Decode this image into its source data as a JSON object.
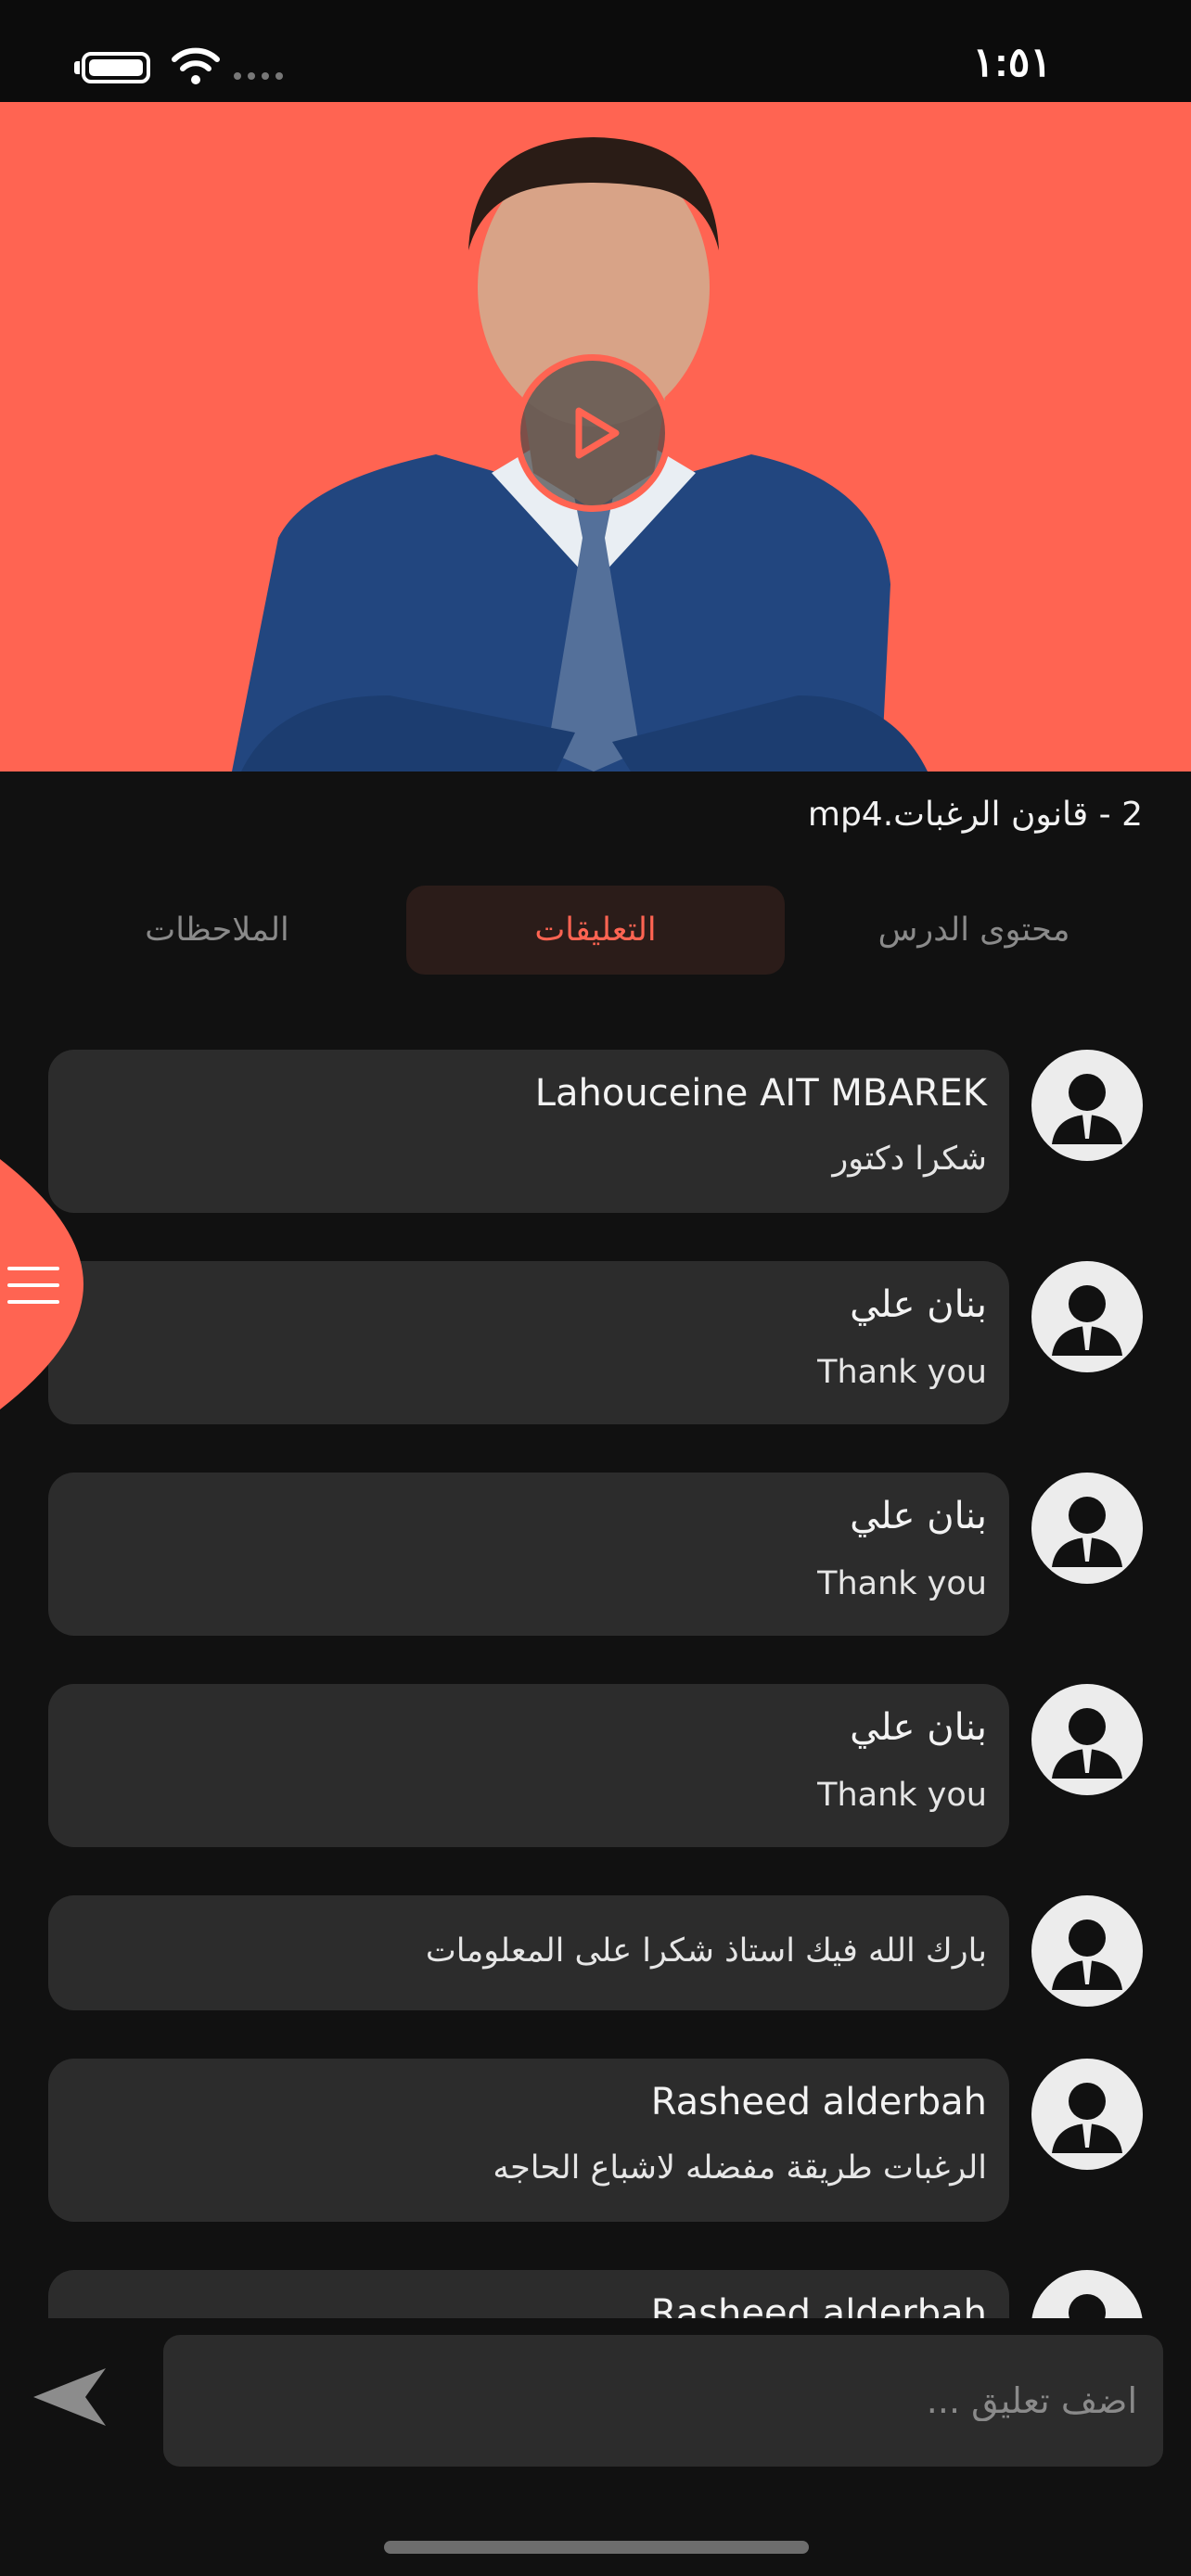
{
  "status_bar": {
    "time": "١:٥١"
  },
  "video": {
    "title": "2 - قانون الرغبات.mp4"
  },
  "tabs": [
    {
      "label": "محتوى الدرس"
    },
    {
      "label": "التعليقات"
    },
    {
      "label": "الملاحظات"
    }
  ],
  "comments": [
    {
      "name": "Lahouceine AIT MBAREK",
      "text": "شكرا دكتور"
    },
    {
      "name": "بنان علي",
      "text": "Thank you"
    },
    {
      "name": "بنان علي",
      "text": "Thank you"
    },
    {
      "name": "بنان علي",
      "text": "Thank you"
    },
    {
      "name": "",
      "text": "بارك الله فيك استاذ شكرا على المعلومات"
    },
    {
      "name": "Rasheed alderbah",
      "text": "الرغبات طريقة مفضله لاشباع الحاجه"
    },
    {
      "name": "Rasheed alderbah",
      "text": ""
    }
  ],
  "comment_input": {
    "placeholder": "اضف تعليق ..."
  },
  "colors": {
    "accent": "#ff6452",
    "background": "#111111",
    "card": "#2c2c2c",
    "active_tab_bg": "#2b1c19"
  },
  "icons": {
    "battery": "battery-icon",
    "wifi": "wifi-icon",
    "play": "play-icon",
    "avatar": "user-avatar-icon",
    "menu": "hamburger-menu-icon",
    "send": "send-icon"
  }
}
